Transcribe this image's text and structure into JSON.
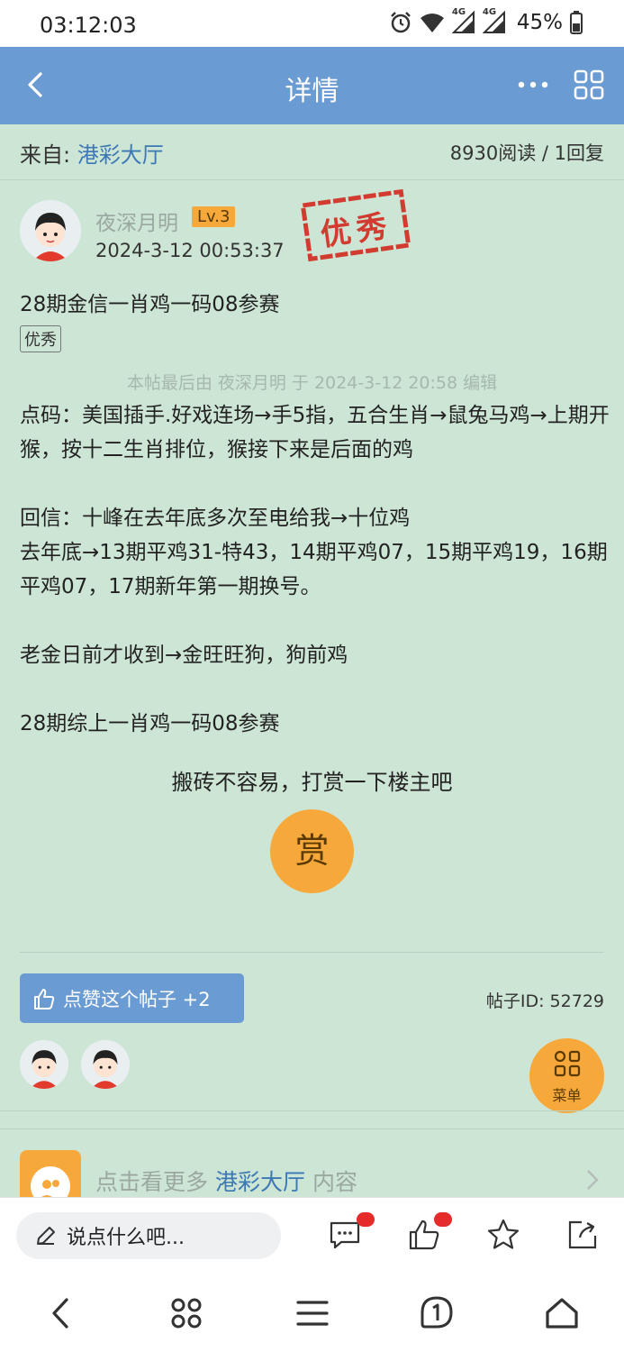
{
  "status_bar": {
    "time": "03:12:03",
    "battery": "45%",
    "net1": "4G",
    "net2": "4G"
  },
  "header": {
    "title": "详情"
  },
  "source": {
    "prefix": "来自:",
    "forum": "港彩大厅",
    "stats": "8930阅读 / 1回复"
  },
  "post": {
    "author": "夜深月明",
    "level": "Lv.3",
    "time": "2024-3-12 00:53:37",
    "stamp_text": "优秀",
    "title": "28期金信一肖鸡一码08参赛",
    "tag": "优秀",
    "edit_note": "本帖最后由 夜深月明 于 2024-3-12 20:58 编辑",
    "paragraphs": [
      "点码：美国插手.好戏连场→手5指，五合生肖→鼠兔马鸡→上期开猴，按十二生肖排位，猴接下来是后面的鸡",
      "回信：十峰在去年底多次至电给我→十位鸡",
      "去年底→13期平鸡31-特43，14期平鸡07，15期平鸡19，16期平鸡07，17期新年第一期换号。",
      "老金日前才收到→金旺旺狗，狗前鸡",
      "28期综上一肖鸡一码08参赛"
    ],
    "reward_prompt": "搬砖不容易，打赏一下楼主吧",
    "reward_button": "赏",
    "like_button": "点赞这个帖子 +2",
    "post_id": "帖子ID: 52729"
  },
  "fab": {
    "label": "菜单"
  },
  "more": {
    "prefix": "点击看更多",
    "forum": "港彩大厅",
    "suffix": "内容"
  },
  "reply_bar": {
    "placeholder": "说点什么吧..."
  },
  "colors": {
    "accent": "#6a9bd3",
    "background": "#cde5d5",
    "orange": "#f6a83a",
    "link": "#3c78b4",
    "badge": "#e62b2b"
  }
}
